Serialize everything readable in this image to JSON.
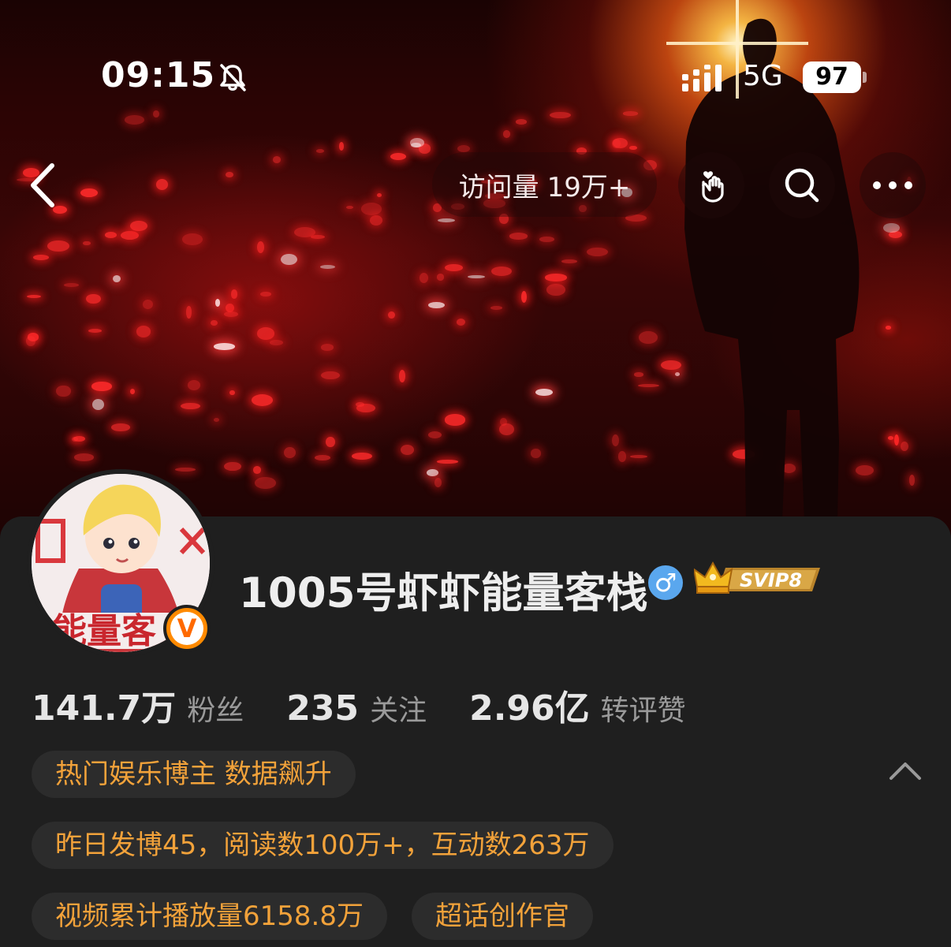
{
  "status_bar": {
    "time": "09:15",
    "network": "5G",
    "battery": "97"
  },
  "nav": {
    "visit_label": "访问量",
    "visit_count": "19万+"
  },
  "profile": {
    "username": "1005号虾虾能量客栈",
    "gender_symbol": "♂",
    "vip_badge_text": "SVIP8",
    "verified_badge": "V",
    "avatar_text": "能量客"
  },
  "stats": [
    {
      "value": "141.7万",
      "label": "粉丝"
    },
    {
      "value": "235",
      "label": "关注"
    },
    {
      "value": "2.96亿",
      "label": "转评赞"
    }
  ],
  "tags": {
    "hot_blogger": "热门娱乐博主 数据飙升",
    "yesterday_stats": "昨日发博45，阅读数100万+，互动数263万",
    "video_views": "视频累计播放量6158.8万",
    "super_topic": "超话创作官"
  },
  "colors": {
    "panel_bg": "#1f1f1f",
    "tag_bg": "#2c2c2c",
    "tag_text": "#f2a23a",
    "verified_orange": "#ff8a00",
    "gender_blue": "#5aa7ee"
  },
  "icons": [
    "back-arrow-icon",
    "bell-off-icon",
    "signal-icon",
    "hand-heart-icon",
    "search-icon",
    "more-icon",
    "chevron-up-icon",
    "crown-icon"
  ]
}
